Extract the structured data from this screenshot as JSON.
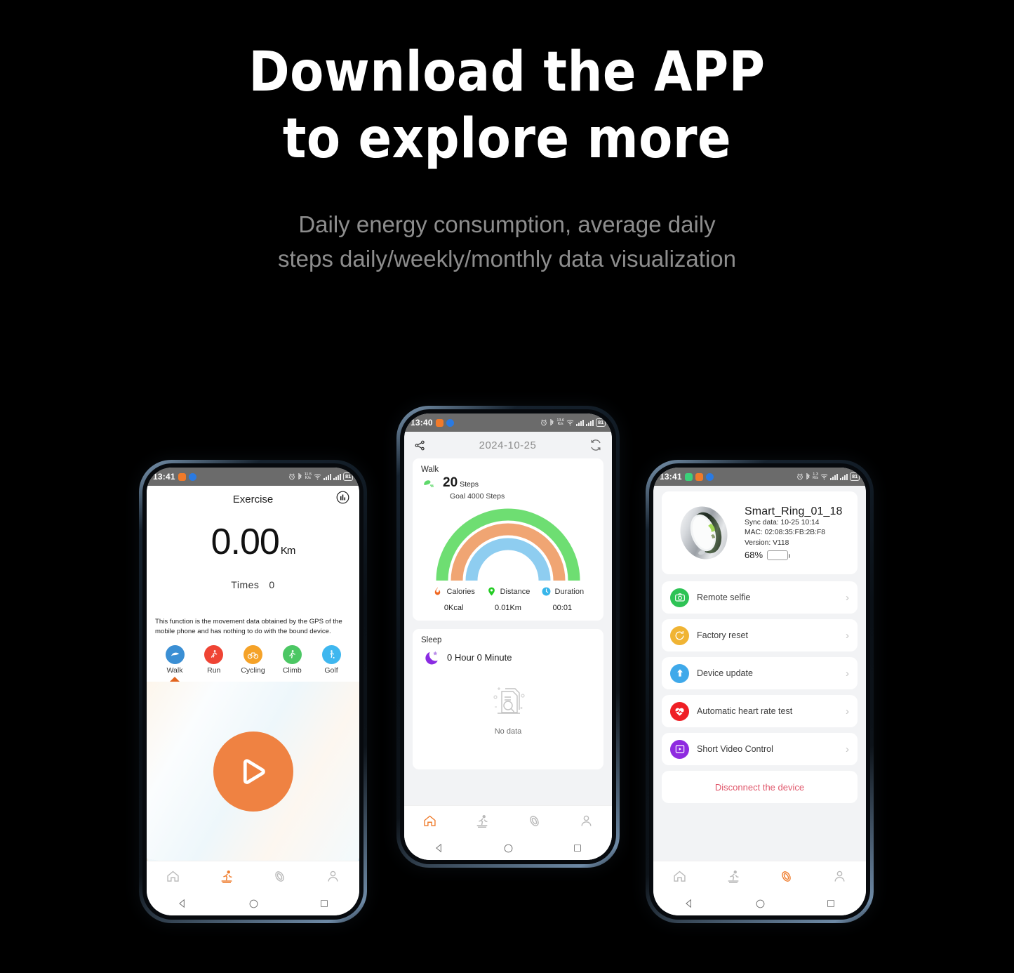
{
  "headline": {
    "line1": "Download the APP",
    "line2": "to explore more"
  },
  "subheadline": {
    "line1": "Daily energy consumption, average daily",
    "line2": "steps daily/weekly/monthly data visualization"
  },
  "colors": {
    "background": "#000000",
    "accent_orange": "#ef8242",
    "headline": "#ffffff",
    "subheadline": "#8d8d8d",
    "disconnect_red": "#e0576b",
    "battery_green": "#1fd21f"
  },
  "phone_left": {
    "status_bar": {
      "time": "13:41",
      "battery": "81",
      "net_speed": "11.5",
      "net_unit": "K/s"
    },
    "header": {
      "title": "Exercise",
      "chart_icon": "bar-chart-icon"
    },
    "distance": {
      "value": "0.00",
      "unit": "Km"
    },
    "times": {
      "label": "Times",
      "value": "0"
    },
    "note": "This function is the movement data obtained by the GPS of the mobile phone and has nothing to do with the bound device.",
    "exercise_types": [
      {
        "label": "Walk",
        "icon": "walk-icon",
        "color": "#3b8fd4",
        "selected": true
      },
      {
        "label": "Run",
        "icon": "run-icon",
        "color": "#ef4434",
        "selected": false
      },
      {
        "label": "Cycling",
        "icon": "cycling-icon",
        "color": "#f5a228",
        "selected": false
      },
      {
        "label": "Climb",
        "icon": "climb-icon",
        "color": "#4cc764",
        "selected": false
      },
      {
        "label": "Golf",
        "icon": "golf-icon",
        "color": "#3fb7ef",
        "selected": false
      }
    ],
    "play_button": {
      "icon": "play-icon",
      "label": "Start"
    },
    "tabs": [
      {
        "name": "home",
        "icon": "home-icon",
        "active": false
      },
      {
        "name": "exercise",
        "icon": "treadmill-icon",
        "active": true
      },
      {
        "name": "device",
        "icon": "ring-icon",
        "active": false
      },
      {
        "name": "profile",
        "icon": "person-icon",
        "active": false
      }
    ]
  },
  "phone_mid": {
    "status_bar": {
      "time": "13:40",
      "battery": "81",
      "net_speed": "13.6",
      "net_unit": "K/s"
    },
    "header": {
      "share_icon": "share-icon",
      "date": "2024-10-25",
      "sync_icon": "refresh-icon"
    },
    "walk_card": {
      "title": "Walk",
      "steps_value": "20",
      "steps_unit": "Steps",
      "goal": "Goal 4000 Steps",
      "arc_colors": [
        "#6ede72",
        "#f0a573",
        "#8ecdf0"
      ],
      "metrics": [
        {
          "label": "Calories",
          "value": "0Kcal",
          "icon": "flame-icon",
          "color": "#f0661f"
        },
        {
          "label": "Distance",
          "value": "0.01Km",
          "icon": "location-pin-icon",
          "color": "#23cc23"
        },
        {
          "label": "Duration",
          "value": "00:01",
          "icon": "clock-icon",
          "color": "#38b6ea"
        }
      ]
    },
    "sleep_card": {
      "title": "Sleep",
      "icon": "moon-star-icon",
      "value": "0 Hour 0 Minute",
      "empty_icon": "no-data-icon",
      "empty_label": "No data"
    },
    "tabs": [
      {
        "name": "home",
        "icon": "home-icon",
        "active": true
      },
      {
        "name": "exercise",
        "icon": "treadmill-icon",
        "active": false
      },
      {
        "name": "device",
        "icon": "ring-icon",
        "active": false
      },
      {
        "name": "profile",
        "icon": "person-icon",
        "active": false
      }
    ]
  },
  "phone_right": {
    "status_bar": {
      "time": "13:41",
      "battery": "81",
      "net_speed": "1.3",
      "net_unit": "K/s"
    },
    "device": {
      "image": "smart-ring-photo",
      "name": "Smart_Ring_01_18",
      "sync": "Sync data: 10-25 10:14",
      "mac": "MAC: 02:08:35:FB:2B:F8",
      "version": "Version: V118",
      "battery_pct": "68%",
      "battery_level": 68
    },
    "functions": [
      {
        "label": "Remote selfie",
        "icon": "camera-icon",
        "color": "#2ec355"
      },
      {
        "label": "Factory reset",
        "icon": "reset-icon",
        "color": "#f0b434"
      },
      {
        "label": "Device update",
        "icon": "upload-arrow-icon",
        "color": "#3fa9ea"
      },
      {
        "label": "Automatic heart rate test",
        "icon": "heart-pulse-icon",
        "color": "#ef1f25"
      },
      {
        "label": "Short Video Control",
        "icon": "video-play-icon",
        "color": "#8f2be0"
      }
    ],
    "disconnect": "Disconnect the device",
    "tabs": [
      {
        "name": "home",
        "icon": "home-icon",
        "active": false
      },
      {
        "name": "exercise",
        "icon": "treadmill-icon",
        "active": false
      },
      {
        "name": "device",
        "icon": "ring-icon",
        "active": true
      },
      {
        "name": "profile",
        "icon": "person-icon",
        "active": false
      }
    ]
  },
  "android_nav": {
    "back": "back-icon",
    "home": "home-circle-icon",
    "recents": "recents-square-icon"
  }
}
